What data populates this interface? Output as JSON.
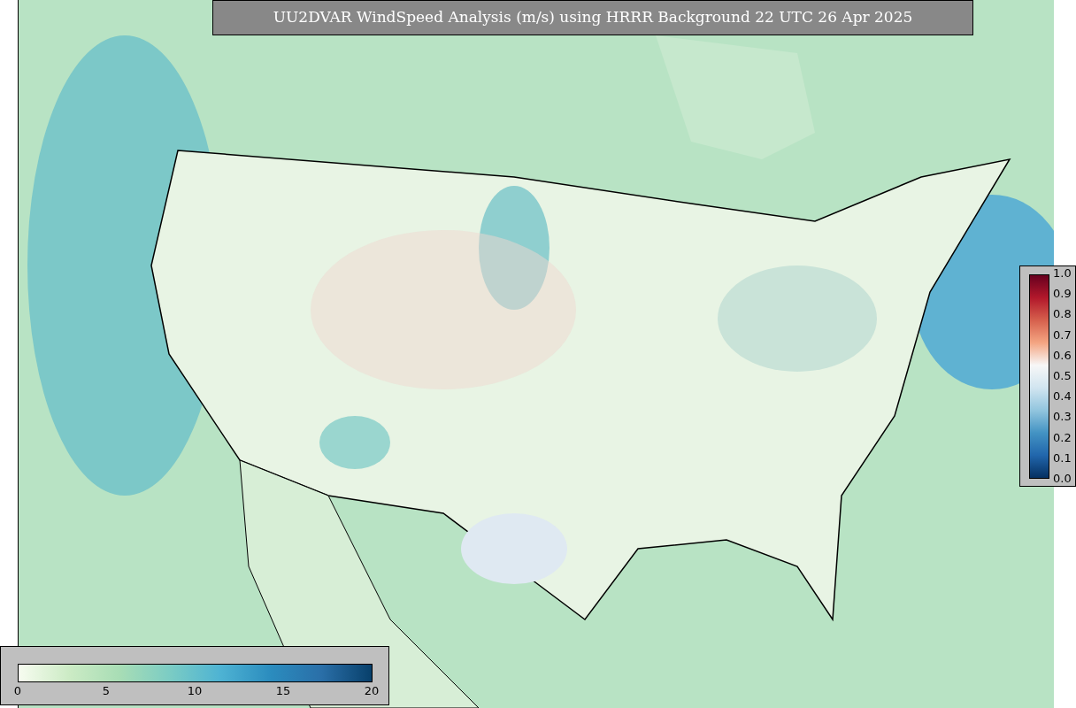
{
  "title": "UU2DVAR WindSpeed Analysis (m/s) using HRRR Background 22 UTC 26 Apr 2025",
  "ratio_colorbar": {
    "ticks": [
      "1.0",
      "0.9",
      "0.8",
      "0.7",
      "0.6",
      "0.5",
      "0.4",
      "0.3",
      "0.2",
      "0.1",
      "0.0"
    ]
  },
  "speed_colorbar": {
    "ticks": [
      "0",
      "5",
      "10",
      "15",
      "20"
    ]
  }
}
